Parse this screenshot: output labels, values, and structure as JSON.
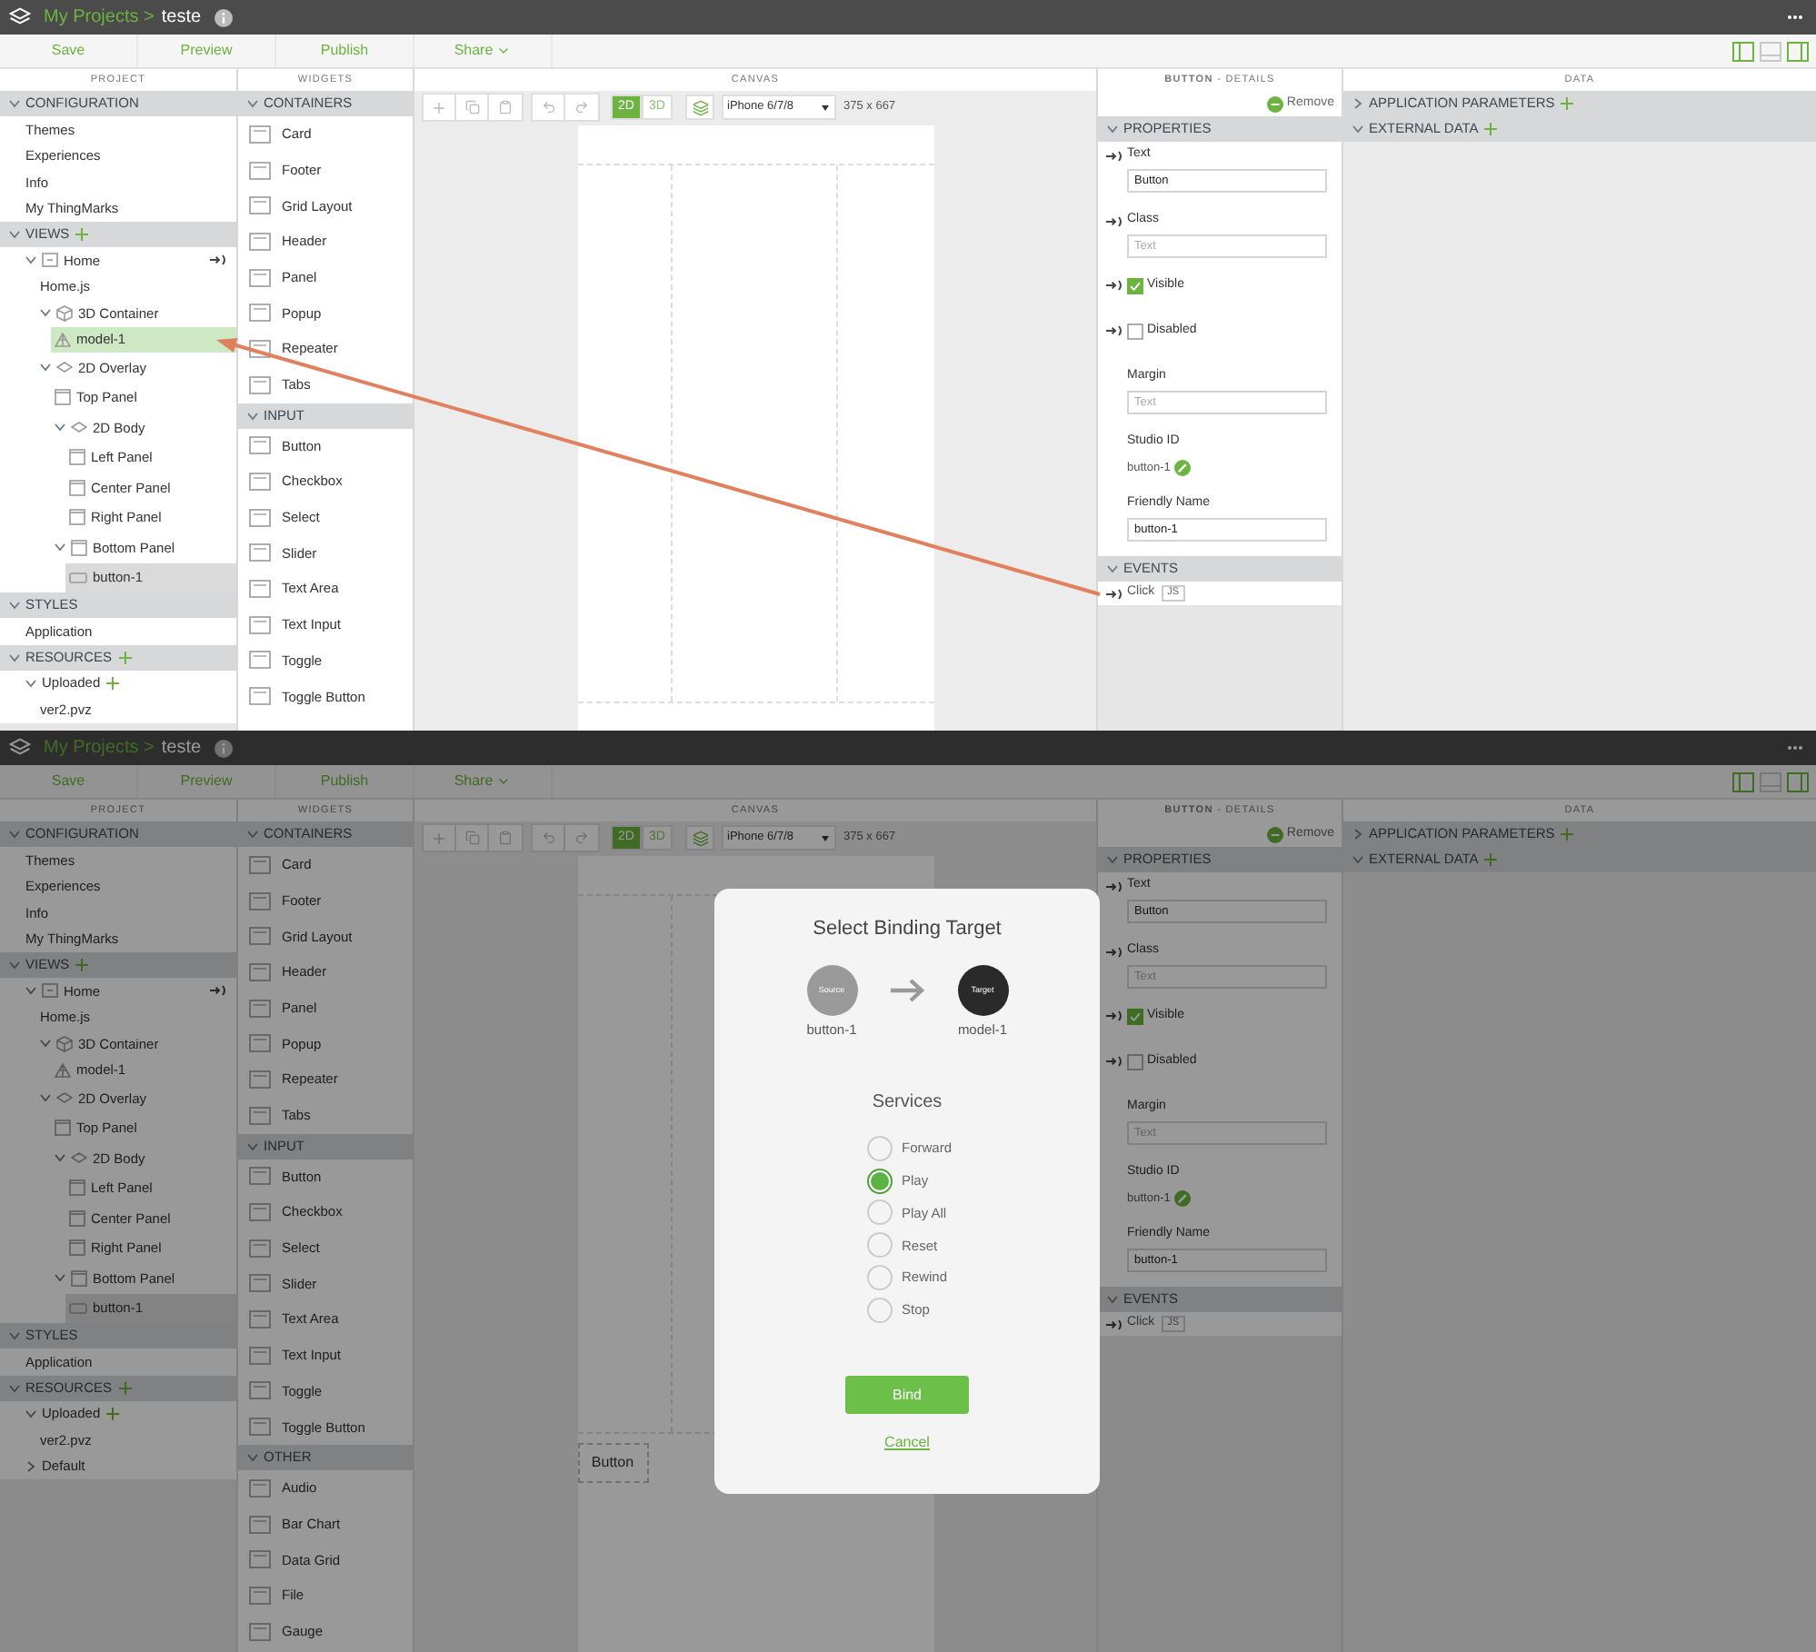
{
  "screens": [
    {
      "header": {
        "breadcrumb": "My Projects >",
        "project": "teste"
      },
      "toolbar": [
        {
          "label": "Save",
          "dropdown": false
        },
        {
          "label": "Preview",
          "dropdown": false
        },
        {
          "label": "Publish",
          "dropdown": false
        },
        {
          "label": "Share",
          "dropdown": true
        }
      ],
      "panel_toggles": [
        {
          "selected": true
        },
        {
          "selected": false
        },
        {
          "selected": true
        }
      ],
      "project": {
        "heading": "PROJECT",
        "sections": [
          {
            "title": "CONFIGURATION",
            "expanded": true,
            "add": false,
            "items": [
              {
                "label": "Themes",
                "kind": "plain",
                "selected": false
              },
              {
                "label": "Experiences",
                "kind": "plain",
                "selected": false
              },
              {
                "label": "Info",
                "kind": "plain",
                "selected": false
              },
              {
                "label": "My ThingMarks",
                "kind": "plain",
                "selected": false
              }
            ]
          },
          {
            "title": "VIEWS",
            "expanded": true,
            "add": true,
            "items": [
              {
                "label": "Home",
                "kind": "view",
                "expanded": true,
                "bindable": true,
                "selected": false,
                "children": [
                  {
                    "label": "Home.js",
                    "kind": "plain",
                    "selected": false
                  },
                  {
                    "label": "3D Container",
                    "kind": "cube",
                    "expanded": true,
                    "selected": false,
                    "children": [
                      {
                        "label": "model-1",
                        "kind": "model",
                        "selected": false,
                        "drop_target": true
                      }
                    ]
                  },
                  {
                    "label": "2D Overlay",
                    "kind": "overlay",
                    "expanded": true,
                    "selected": false,
                    "children": [
                      {
                        "label": "Top Panel",
                        "kind": "panel",
                        "selected": false
                      },
                      {
                        "label": "2D Body",
                        "kind": "overlay",
                        "expanded": true,
                        "selected": false,
                        "children": [
                          {
                            "label": "Left Panel",
                            "kind": "panel",
                            "selected": false
                          },
                          {
                            "label": "Center Panel",
                            "kind": "panel",
                            "selected": false
                          },
                          {
                            "label": "Right Panel",
                            "kind": "panel",
                            "selected": false
                          }
                        ]
                      },
                      {
                        "label": "Bottom Panel",
                        "kind": "panel",
                        "expanded": true,
                        "selected": false,
                        "children": [
                          {
                            "label": "button-1",
                            "kind": "button",
                            "selected": true
                          }
                        ]
                      }
                    ]
                  }
                ]
              }
            ]
          },
          {
            "title": "STYLES",
            "expanded": true,
            "add": false,
            "items": [
              {
                "label": "Application",
                "kind": "plain",
                "selected": false
              }
            ]
          },
          {
            "title": "RESOURCES",
            "expanded": true,
            "add": true,
            "items": [
              {
                "label": "Uploaded",
                "kind": "plain",
                "expanded": true,
                "add": true,
                "selected": false,
                "children": [
                  {
                    "label": "ver2.pvz",
                    "kind": "plain",
                    "selected": false
                  }
                ]
              }
            ]
          }
        ]
      },
      "widgets": {
        "heading": "WIDGETS",
        "sections": [
          {
            "title": "CONTAINERS",
            "expanded": true,
            "items": [
              "Card",
              "Footer",
              "Grid Layout",
              "Header",
              "Panel",
              "Popup",
              "Repeater",
              "Tabs"
            ]
          },
          {
            "title": "INPUT",
            "expanded": true,
            "items": [
              "Button",
              "Checkbox",
              "Select",
              "Slider",
              "Text Area",
              "Text Input",
              "Toggle",
              "Toggle Button"
            ]
          }
        ]
      },
      "canvas": {
        "heading": "CANVAS",
        "modes": [
          {
            "label": "2D",
            "selected": true
          },
          {
            "label": "3D",
            "selected": false
          }
        ],
        "device": "iPhone 6/7/8",
        "resolution": "375 x 667"
      },
      "details": {
        "heading": "**BUTTON** - DETAILS",
        "remove": "Remove",
        "properties_title": "PROPERTIES",
        "properties": [
          {
            "kind": "text",
            "label": "Text",
            "value": "Button",
            "bindable": true
          },
          {
            "kind": "text",
            "label": "Class",
            "placeholder": "Text",
            "bindable": true
          },
          {
            "kind": "checkbox",
            "label": "Visible",
            "checked": true,
            "bindable": true
          },
          {
            "kind": "checkbox",
            "label": "Disabled",
            "checked": false,
            "bindable": true
          },
          {
            "kind": "text",
            "label": "Margin",
            "placeholder": "Text",
            "bindable": false
          },
          {
            "kind": "id",
            "label": "Studio ID",
            "value": "button-1"
          },
          {
            "kind": "text",
            "label": "Friendly Name",
            "value": "button-1",
            "bindable": false
          }
        ],
        "events_title": "EVENTS",
        "events": [
          {
            "label": "Click",
            "code": "JS"
          }
        ]
      },
      "data": {
        "heading": "DATA",
        "sections": [
          {
            "title": "APPLICATION PARAMETERS",
            "expanded": false,
            "add": true
          },
          {
            "title": "EXTERNAL DATA",
            "expanded": true,
            "add": true
          }
        ]
      },
      "drag_arrow": true,
      "dimmed": false
    },
    {
      "header": {
        "breadcrumb": "My Projects >",
        "project": "teste"
      },
      "toolbar": [
        {
          "label": "Save",
          "dropdown": false
        },
        {
          "label": "Preview",
          "dropdown": false
        },
        {
          "label": "Publish",
          "dropdown": false
        },
        {
          "label": "Share",
          "dropdown": true
        }
      ],
      "panel_toggles": [
        {
          "selected": true
        },
        {
          "selected": false
        },
        {
          "selected": true
        }
      ],
      "project": {
        "heading": "PROJECT",
        "sections": [
          {
            "title": "CONFIGURATION",
            "expanded": true,
            "add": false,
            "items": [
              {
                "label": "Themes",
                "kind": "plain",
                "selected": false
              },
              {
                "label": "Experiences",
                "kind": "plain",
                "selected": false
              },
              {
                "label": "Info",
                "kind": "plain",
                "selected": false
              },
              {
                "label": "My ThingMarks",
                "kind": "plain",
                "selected": false
              }
            ]
          },
          {
            "title": "VIEWS",
            "expanded": true,
            "add": true,
            "items": [
              {
                "label": "Home",
                "kind": "view",
                "expanded": true,
                "bindable": true,
                "selected": false,
                "children": [
                  {
                    "label": "Home.js",
                    "kind": "plain",
                    "selected": false
                  },
                  {
                    "label": "3D Container",
                    "kind": "cube",
                    "expanded": true,
                    "selected": false,
                    "children": [
                      {
                        "label": "model-1",
                        "kind": "model",
                        "selected": false,
                        "drop_target": false
                      }
                    ]
                  },
                  {
                    "label": "2D Overlay",
                    "kind": "overlay",
                    "expanded": true,
                    "selected": false,
                    "children": [
                      {
                        "label": "Top Panel",
                        "kind": "panel",
                        "selected": false
                      },
                      {
                        "label": "2D Body",
                        "kind": "overlay",
                        "expanded": true,
                        "selected": false,
                        "children": [
                          {
                            "label": "Left Panel",
                            "kind": "panel",
                            "selected": false
                          },
                          {
                            "label": "Center Panel",
                            "kind": "panel",
                            "selected": false
                          },
                          {
                            "label": "Right Panel",
                            "kind": "panel",
                            "selected": false
                          }
                        ]
                      },
                      {
                        "label": "Bottom Panel",
                        "kind": "panel",
                        "expanded": true,
                        "selected": false,
                        "children": [
                          {
                            "label": "button-1",
                            "kind": "button",
                            "selected": true
                          }
                        ]
                      }
                    ]
                  }
                ]
              }
            ]
          },
          {
            "title": "STYLES",
            "expanded": true,
            "add": false,
            "items": [
              {
                "label": "Application",
                "kind": "plain",
                "selected": false
              }
            ]
          },
          {
            "title": "RESOURCES",
            "expanded": true,
            "add": true,
            "items": [
              {
                "label": "Uploaded",
                "kind": "plain",
                "expanded": true,
                "add": true,
                "selected": false,
                "children": [
                  {
                    "label": "ver2.pvz",
                    "kind": "plain",
                    "selected": false
                  }
                ]
              },
              {
                "label": "Default",
                "kind": "plain",
                "expanded": false,
                "selected": false
              }
            ]
          }
        ]
      },
      "widgets": {
        "heading": "WIDGETS",
        "sections": [
          {
            "title": "CONTAINERS",
            "expanded": true,
            "items": [
              "Card",
              "Footer",
              "Grid Layout",
              "Header",
              "Panel",
              "Popup",
              "Repeater",
              "Tabs"
            ]
          },
          {
            "title": "INPUT",
            "expanded": true,
            "items": [
              "Button",
              "Checkbox",
              "Select",
              "Slider",
              "Text Area",
              "Text Input",
              "Toggle",
              "Toggle Button"
            ]
          },
          {
            "title": "OTHER",
            "expanded": true,
            "items": [
              "Audio",
              "Bar Chart",
              "Data Grid",
              "File",
              "Gauge"
            ]
          }
        ]
      },
      "canvas": {
        "heading": "CANVAS",
        "modes": [
          {
            "label": "2D",
            "selected": true
          },
          {
            "label": "3D",
            "selected": false
          }
        ],
        "device": "iPhone 6/7/8",
        "resolution": "375 x 667",
        "bottom_widget": "Button"
      },
      "details": {
        "heading": "**BUTTON** - DETAILS",
        "remove": "Remove",
        "properties_title": "PROPERTIES",
        "properties": [
          {
            "kind": "text",
            "label": "Text",
            "value": "Button",
            "bindable": true
          },
          {
            "kind": "text",
            "label": "Class",
            "placeholder": "Text",
            "bindable": true
          },
          {
            "kind": "checkbox",
            "label": "Visible",
            "checked": true,
            "bindable": true
          },
          {
            "kind": "checkbox",
            "label": "Disabled",
            "checked": false,
            "bindable": true
          },
          {
            "kind": "text",
            "label": "Margin",
            "placeholder": "Text",
            "bindable": false
          },
          {
            "kind": "id",
            "label": "Studio ID",
            "value": "button-1"
          },
          {
            "kind": "text",
            "label": "Friendly Name",
            "value": "button-1",
            "bindable": false
          }
        ],
        "events_title": "EVENTS",
        "events": [
          {
            "label": "Click",
            "code": "JS"
          }
        ]
      },
      "data": {
        "heading": "DATA",
        "sections": [
          {
            "title": "APPLICATION PARAMETERS",
            "expanded": false,
            "add": true
          },
          {
            "title": "EXTERNAL DATA",
            "expanded": true,
            "add": true
          }
        ]
      },
      "drag_arrow": false,
      "dimmed": true,
      "dialog": {
        "title": "Select Binding Target",
        "source": {
          "badge": "Source",
          "name": "button-1"
        },
        "target": {
          "badge": "Target",
          "name": "model-1"
        },
        "services_title": "Services",
        "services": [
          {
            "label": "Forward",
            "selected": false
          },
          {
            "label": "Play",
            "selected": true
          },
          {
            "label": "Play All",
            "selected": false
          },
          {
            "label": "Reset",
            "selected": false
          },
          {
            "label": "Rewind",
            "selected": false
          },
          {
            "label": "Stop",
            "selected": false
          }
        ],
        "confirm": "Bind",
        "cancel": "Cancel"
      }
    }
  ]
}
